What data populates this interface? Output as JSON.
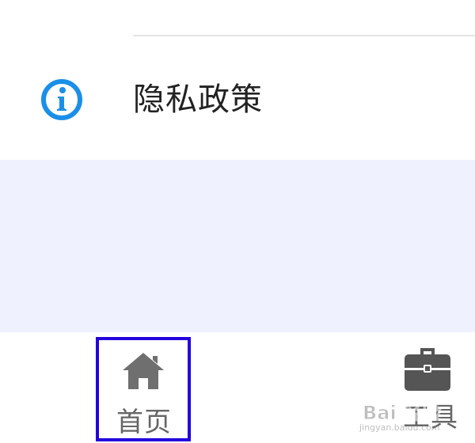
{
  "menu": {
    "privacy_label": "隐私政策",
    "privacy_icon": "info-circle-icon",
    "accent_color": "#1a8fe8"
  },
  "tabbar": {
    "home_label": "首页",
    "home_icon": "home-icon",
    "tools_label": "工具",
    "tools_icon": "toolbox-icon",
    "highlight_color": "#2200dd"
  },
  "watermark": {
    "logo_text": "Bai 经验",
    "url_text": "jingyan.baidu.com"
  }
}
